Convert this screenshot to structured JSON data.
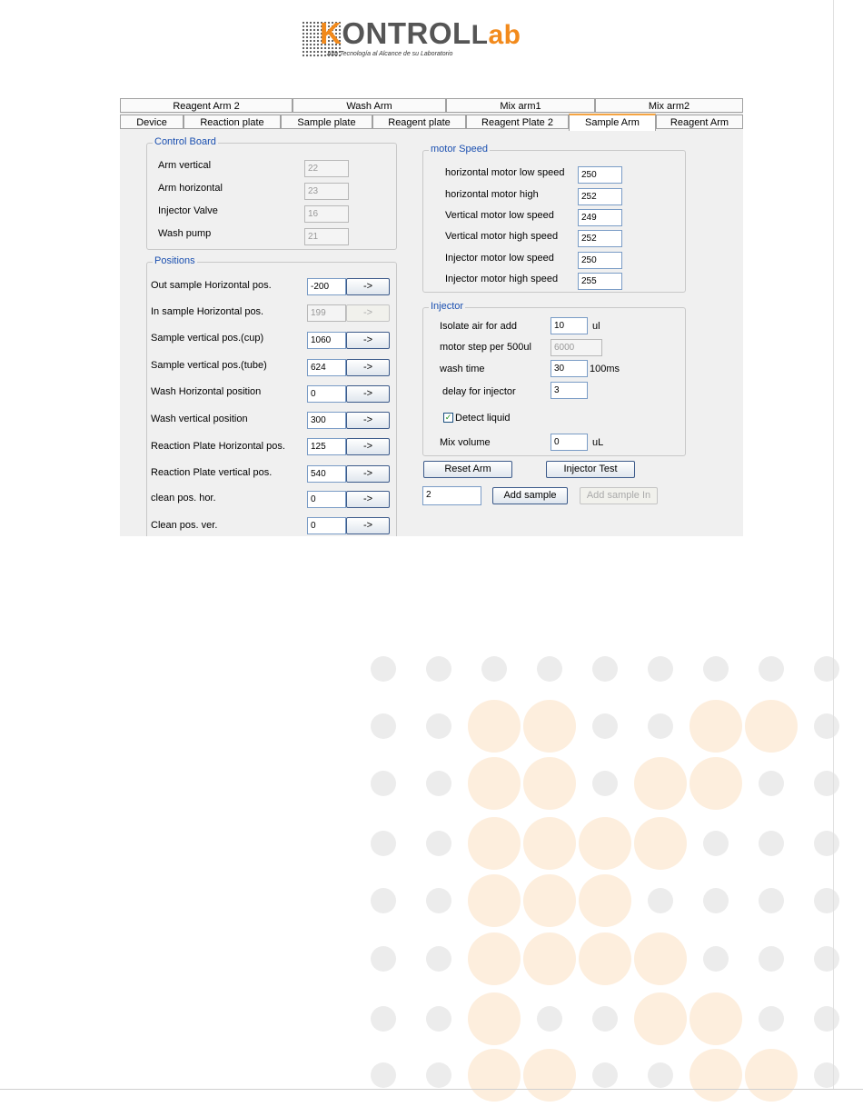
{
  "logo": {
    "text_main": "ONTROL",
    "text_k": "K",
    "text_lab": "ab",
    "text_l": "L",
    "tagline": "Alta Tecnología al Alcance de su Laboratorio"
  },
  "tabs_row1": [
    "Reagent Arm 2",
    "Wash Arm",
    "Mix arm1",
    "Mix arm2"
  ],
  "tabs_row2": [
    "Device",
    "Reaction plate",
    "Sample plate",
    "Reagent plate",
    "Reagent Plate 2",
    "Sample Arm",
    "Reagent Arm"
  ],
  "active_tab": "Sample Arm",
  "control_board": {
    "title": "Control Board",
    "rows": [
      {
        "label": "Arm vertical",
        "value": "22"
      },
      {
        "label": "Arm horizontal",
        "value": "23"
      },
      {
        "label": "Injector Valve",
        "value": "16"
      },
      {
        "label": "Wash pump",
        "value": "21"
      }
    ]
  },
  "positions": {
    "title": "Positions",
    "go_label": "->",
    "rows": [
      {
        "label": "Out sample Horizontal pos.",
        "value": "-200"
      },
      {
        "label": "In sample Horizontal pos.",
        "value": "199"
      },
      {
        "label": "Sample vertical pos.(cup)",
        "value": "1060"
      },
      {
        "label": "Sample vertical pos.(tube)",
        "value": "624"
      },
      {
        "label": "Wash Horizontal position",
        "value": "0"
      },
      {
        "label": "Wash vertical position",
        "value": "300"
      },
      {
        "label": "Reaction Plate Horizontal pos.",
        "value": "125"
      },
      {
        "label": "Reaction Plate vertical pos.",
        "value": "540"
      },
      {
        "label": "clean pos. hor.",
        "value": "0"
      },
      {
        "label": "Clean pos. ver.",
        "value": "0"
      }
    ]
  },
  "motor_speed": {
    "title": "motor  Speed",
    "rows": [
      {
        "label": "horizontal motor low speed",
        "value": "250"
      },
      {
        "label": "horizontal motor high",
        "value": "252"
      },
      {
        "label": "Vertical  motor low speed",
        "value": "249"
      },
      {
        "label": "Vertical  motor high speed",
        "value": "252"
      },
      {
        "label": "Injector  motor low speed",
        "value": "250"
      },
      {
        "label": "Injector  motor high speed",
        "value": "255"
      }
    ]
  },
  "injector": {
    "title": "Injector",
    "isolate_air_label": "Isolate air for add",
    "isolate_air_value": "10",
    "isolate_air_unit": "ul",
    "motor_step_label": "motor step per 500ul",
    "motor_step_value": "6000",
    "wash_time_label": "wash time",
    "wash_time_value": "30",
    "wash_time_unit": "100ms",
    "delay_label": "delay for injector",
    "delay_value": "3",
    "detect_liquid_label": "Detect liquid",
    "detect_liquid_checked": true,
    "mix_volume_label": "Mix volume",
    "mix_volume_value": "0",
    "mix_volume_unit": "uL"
  },
  "actions": {
    "reset_arm": "Reset Arm",
    "injector_test": "Injector Test",
    "sample_value": "2",
    "add_sample": "Add sample",
    "add_sample_in": "Add sample In"
  },
  "colors": {
    "accent_orange": "#f28a1c",
    "group_title_blue": "#1a4fb0",
    "dot_gray": "#ececec",
    "dot_orange": "#fdeedd"
  }
}
